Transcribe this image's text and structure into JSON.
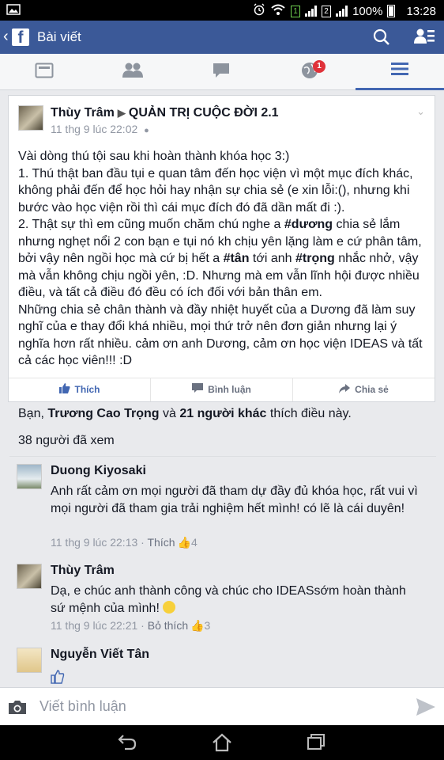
{
  "status_bar": {
    "battery": "100%",
    "time": "13:28",
    "sim1": "1",
    "sim2": "2"
  },
  "app_bar": {
    "logo": "f",
    "title": "Bài viết",
    "icons": [
      "search-icon",
      "friend-requests-icon"
    ]
  },
  "tabs": {
    "notification_count": "1",
    "active": "menu",
    "items": [
      "news-feed",
      "friends",
      "messages",
      "notifications",
      "menu"
    ]
  },
  "post": {
    "author": "Thùy Trâm",
    "group": "QUẢN TRỊ CUỘC ĐỜI 2.1",
    "timestamp": "11 thg 9 lúc 22:02",
    "lines": [
      [
        "Vài dòng thú tội sau khi hoàn thành khóa học 3:)"
      ],
      [
        "1. Thú thật ban đầu tụi e quan tâm đến học viện vì một mục đích khác, không phải đến để học hỏi hay nhận sự chia sẻ  (e xin lỗi:(), nhưng khi bước vào học viện rồi thì cái mục đích đó đã dần mất đi :)."
      ],
      [
        "2. Thật sự thì em cũng muốn chăm chú nghe a ",
        "#dương",
        "  chia sẻ lắm nhưng nghẹt nổi 2 con bạn e tụi nó kh chịu yên lặng làm e cứ phân tâm, bởi vậy nên ngồi học mà cứ bị hết a ",
        "#tân",
        " tới anh ",
        "#trọng",
        " nhắc nhở, vậy mà vẫn không chịu ngồi yên, :D. Nhưng mà em vẫn lĩnh hội được nhiều điều, và tất cả điều đó đều có ích đối với bản thân em."
      ],
      [
        "Những chia sẻ chân thành và đầy nhiệt huyết của a Dương đã làm suy nghĩ của e thay đổi khá nhiều, mọi thứ trở nên đơn giản nhưng lại ý nghĩa hơn rất nhiều. cảm ơn anh Dương, cảm ơn học viện IDEAS và tất cả các học viên!!! :D"
      ]
    ],
    "actions": {
      "like": "Thích",
      "comment": "Bình luận",
      "share": "Chia sẻ"
    },
    "likes": {
      "prefix": "Bạn, ",
      "name": "Trương Cao Trọng",
      "mid": " và ",
      "others": "21 người khác",
      "suffix": " thích điều này."
    },
    "seen": "38 người đã xem"
  },
  "comments": [
    {
      "author": "Duong Kiyosaki",
      "text": "Anh rất cảm ơn mọi người đã tham dự đầy đủ khóa học, rất vui vì mọi người đã tham gia trải nghiệm hết mình! có lẽ là cái duyên!",
      "time": "11 thg 9 lúc 22:13",
      "sep": " · ",
      "like_label": "Thích",
      "like_count": "4"
    },
    {
      "author": "Thùy Trâm",
      "text": "Dạ, e chúc anh thành công và chúc cho IDEASsớm hoàn thành sứ mệnh của mình!",
      "time": "11 thg 9 lúc 22:21",
      "sep": " · ",
      "like_label": "Bỏ thích",
      "like_count": "3"
    },
    {
      "author": "Nguyễn Viết Tân"
    }
  ],
  "composer": {
    "placeholder": "Viết bình luận"
  }
}
